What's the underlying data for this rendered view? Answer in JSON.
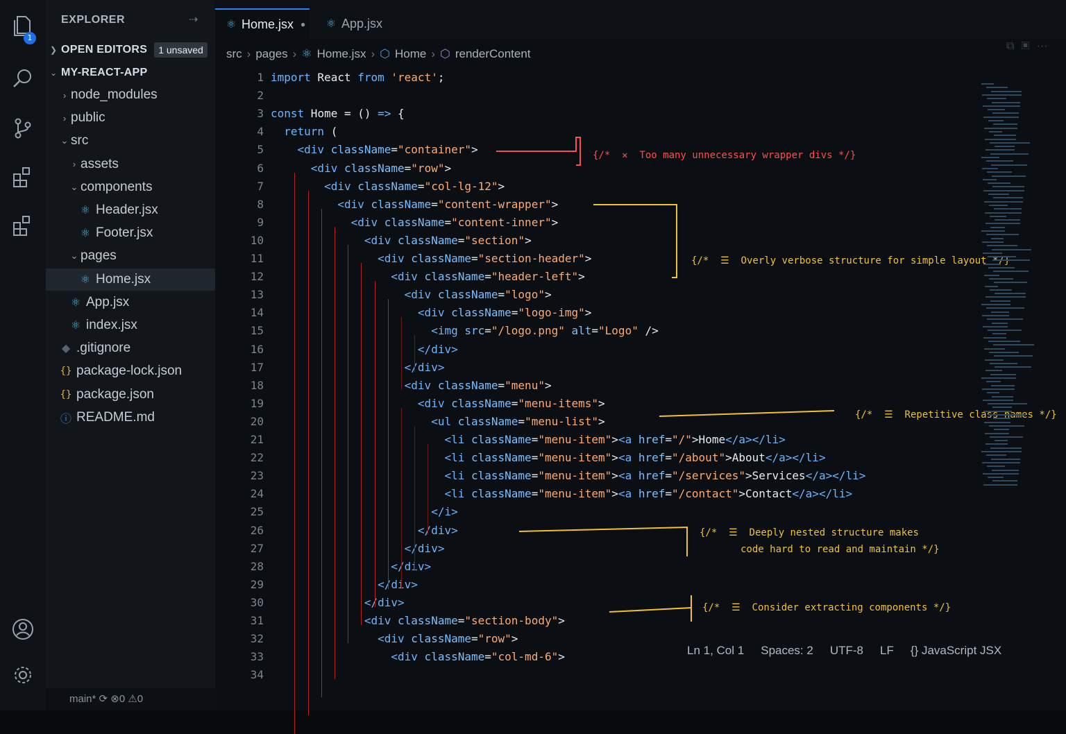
{
  "activity_bar": {
    "explorer_badge": "1"
  },
  "sidebar": {
    "title": "EXPLORER",
    "more_icon": "⇢",
    "open_editors": {
      "label": "OPEN EDITORS",
      "badge": "1 unsaved"
    },
    "project": {
      "label": "MY-REACT-APP"
    },
    "items": [
      {
        "label": "node_modules",
        "type": "folder",
        "state": "collapsed",
        "depth": 1
      },
      {
        "label": "public",
        "type": "folder",
        "state": "collapsed",
        "depth": 1
      },
      {
        "label": "src",
        "type": "folder",
        "state": "expanded",
        "depth": 1
      },
      {
        "label": "assets",
        "type": "folder",
        "state": "collapsed",
        "depth": 2
      },
      {
        "label": "components",
        "type": "folder",
        "state": "expanded",
        "depth": 2
      },
      {
        "label": "Header.jsx",
        "type": "react",
        "depth": 3
      },
      {
        "label": "Footer.jsx",
        "type": "react",
        "depth": 3
      },
      {
        "label": "pages",
        "type": "folder",
        "state": "expanded",
        "depth": 2
      },
      {
        "label": "Home.jsx",
        "type": "react",
        "depth": 3,
        "selected": true
      },
      {
        "label": "App.jsx",
        "type": "react",
        "depth": 2
      },
      {
        "label": "index.jsx",
        "type": "react",
        "depth": 2
      },
      {
        "label": ".gitignore",
        "type": "git",
        "depth": 1
      },
      {
        "label": "package-lock.json",
        "type": "json",
        "depth": 1
      },
      {
        "label": "package.json",
        "type": "json",
        "depth": 1
      },
      {
        "label": "README.md",
        "type": "info",
        "depth": 1
      }
    ],
    "bottom_status": "main*   ⟳   ⊗0 ⚠0"
  },
  "tabs": [
    {
      "label": "Home.jsx",
      "active": true,
      "dirty": true
    },
    {
      "label": "App.jsx",
      "active": false
    }
  ],
  "breadcrumb": [
    "src",
    "pages",
    "Home.jsx",
    "Home",
    "renderContent"
  ],
  "code_lines": [
    [
      [
        "kw",
        "import"
      ],
      [
        "pl",
        " React "
      ],
      [
        "kw",
        "from"
      ],
      [
        "st",
        " 'react'"
      ],
      [
        "pl",
        ";"
      ]
    ],
    [],
    [
      [
        "kw",
        "const"
      ],
      [
        "pl",
        " Home = () "
      ],
      [
        "kw",
        "=>"
      ],
      [
        "pl",
        " {"
      ]
    ],
    [
      [
        "kw",
        "  return"
      ],
      [
        "pl",
        " ("
      ]
    ],
    [
      [
        "tg",
        "    <div"
      ],
      [
        "at",
        " className"
      ],
      [
        "pl",
        "="
      ],
      [
        "st",
        "\"container\""
      ],
      [
        "pl",
        ">"
      ]
    ],
    [
      [
        "tg",
        "      <div"
      ],
      [
        "at",
        " className"
      ],
      [
        "pl",
        "="
      ],
      [
        "st",
        "\"row\""
      ],
      [
        "pl",
        ">"
      ]
    ],
    [
      [
        "tg",
        "        <div"
      ],
      [
        "at",
        " className"
      ],
      [
        "pl",
        "="
      ],
      [
        "st",
        "\"col-lg-12\""
      ],
      [
        "pl",
        ">"
      ]
    ],
    [
      [
        "tg",
        "          <div"
      ],
      [
        "at",
        " className"
      ],
      [
        "pl",
        "="
      ],
      [
        "st",
        "\"content-wrapper\""
      ],
      [
        "pl",
        ">"
      ]
    ],
    [
      [
        "tg",
        "            <div"
      ],
      [
        "at",
        " className"
      ],
      [
        "pl",
        "="
      ],
      [
        "st",
        "\"content-inner\""
      ],
      [
        "pl",
        ">"
      ]
    ],
    [
      [
        "tg",
        "              <div"
      ],
      [
        "at",
        " className"
      ],
      [
        "pl",
        "="
      ],
      [
        "st",
        "\"section\""
      ],
      [
        "pl",
        ">"
      ]
    ],
    [
      [
        "tg",
        "                <div"
      ],
      [
        "at",
        " className"
      ],
      [
        "pl",
        "="
      ],
      [
        "st",
        "\"section-header\""
      ],
      [
        "pl",
        ">"
      ]
    ],
    [
      [
        "tg",
        "                  <div"
      ],
      [
        "at",
        " className"
      ],
      [
        "pl",
        "="
      ],
      [
        "st",
        "\"header-left\""
      ],
      [
        "pl",
        ">"
      ]
    ],
    [
      [
        "tg",
        "                    <div"
      ],
      [
        "at",
        " className"
      ],
      [
        "pl",
        "="
      ],
      [
        "st",
        "\"logo\""
      ],
      [
        "pl",
        ">"
      ]
    ],
    [
      [
        "tg",
        "                      <div"
      ],
      [
        "at",
        " className"
      ],
      [
        "pl",
        "="
      ],
      [
        "st",
        "\"logo-img\""
      ],
      [
        "pl",
        ">"
      ]
    ],
    [
      [
        "tg",
        "                        <img"
      ],
      [
        "at",
        " src"
      ],
      [
        "pl",
        "="
      ],
      [
        "st",
        "\"/logo.png\""
      ],
      [
        "at",
        " alt"
      ],
      [
        "pl",
        "="
      ],
      [
        "st",
        "\"Logo\""
      ],
      [
        "pl",
        " />"
      ]
    ],
    [
      [
        "tg",
        "                      </div>"
      ]
    ],
    [
      [
        "tg",
        "                    </div>"
      ]
    ],
    [
      [
        "tg",
        "                    <div"
      ],
      [
        "at",
        " className"
      ],
      [
        "pl",
        "="
      ],
      [
        "st",
        "\"menu\""
      ],
      [
        "pl",
        ">"
      ]
    ],
    [
      [
        "tg",
        "                      <div"
      ],
      [
        "at",
        " className"
      ],
      [
        "pl",
        "="
      ],
      [
        "st",
        "\"menu-items\""
      ],
      [
        "pl",
        ">"
      ]
    ],
    [
      [
        "tg",
        "                        <ul"
      ],
      [
        "at",
        " className"
      ],
      [
        "pl",
        "="
      ],
      [
        "st",
        "\"menu-list\""
      ],
      [
        "pl",
        ">"
      ]
    ],
    [
      [
        "tg",
        "                          <li"
      ],
      [
        "at",
        " className"
      ],
      [
        "pl",
        "="
      ],
      [
        "st",
        "\"menu-item\""
      ],
      [
        "pl",
        ">"
      ],
      [
        "tg",
        "<a"
      ],
      [
        "at",
        " href"
      ],
      [
        "pl",
        "="
      ],
      [
        "st",
        "\"/\""
      ],
      [
        "pl",
        ">Home"
      ],
      [
        "tg",
        "</a></li>"
      ]
    ],
    [
      [
        "tg",
        "                          <li"
      ],
      [
        "at",
        " className"
      ],
      [
        "pl",
        "="
      ],
      [
        "st",
        "\"menu-item\""
      ],
      [
        "pl",
        ">"
      ],
      [
        "tg",
        "<a"
      ],
      [
        "at",
        " href"
      ],
      [
        "pl",
        "="
      ],
      [
        "st",
        "\"/about\""
      ],
      [
        "pl",
        ">About"
      ],
      [
        "tg",
        "</a></li>"
      ]
    ],
    [
      [
        "tg",
        "                          <li"
      ],
      [
        "at",
        " className"
      ],
      [
        "pl",
        "="
      ],
      [
        "st",
        "\"menu-item\""
      ],
      [
        "pl",
        ">"
      ],
      [
        "tg",
        "<a"
      ],
      [
        "at",
        " href"
      ],
      [
        "pl",
        "="
      ],
      [
        "st",
        "\"/services\""
      ],
      [
        "pl",
        ">Services"
      ],
      [
        "tg",
        "</a></li>"
      ]
    ],
    [
      [
        "tg",
        "                          <li"
      ],
      [
        "at",
        " className"
      ],
      [
        "pl",
        "="
      ],
      [
        "st",
        "\"menu-item\""
      ],
      [
        "pl",
        ">"
      ],
      [
        "tg",
        "<a"
      ],
      [
        "at",
        " href"
      ],
      [
        "pl",
        "="
      ],
      [
        "st",
        "\"/contact\""
      ],
      [
        "pl",
        ">Contact"
      ],
      [
        "tg",
        "</a></li>"
      ]
    ],
    [
      [
        "tg",
        "                        </i>"
      ]
    ],
    [
      [
        "tg",
        "                      </div>"
      ]
    ],
    [
      [
        "tg",
        "                    </div>"
      ]
    ],
    [
      [
        "tg",
        "                  </div>"
      ]
    ],
    [
      [
        "tg",
        "                </div>"
      ]
    ],
    [
      [
        "tg",
        "              </div>"
      ]
    ],
    [
      [
        "tg",
        "              <div"
      ],
      [
        "at",
        " className"
      ],
      [
        "pl",
        "="
      ],
      [
        "st",
        "\"section-body\""
      ],
      [
        "pl",
        ">"
      ]
    ],
    [
      [
        "tg",
        "                <div"
      ],
      [
        "at",
        " className"
      ],
      [
        "pl",
        "="
      ],
      [
        "st",
        "\"row\""
      ],
      [
        "pl",
        ">"
      ]
    ],
    [
      [
        "tg",
        "                  <div"
      ],
      [
        "at",
        " className"
      ],
      [
        "pl",
        "="
      ],
      [
        "st",
        "\"col-md-6\""
      ],
      [
        "pl",
        ">"
      ]
    ],
    []
  ],
  "annotations": [
    {
      "text": "{/*  ✕  Too many unnecessary wrapper divs */}",
      "color": "#ff4d4d"
    },
    {
      "text": "{/*  ☰  Overly verbose structure for simple layout */}",
      "color": "#f2c230"
    },
    {
      "text": "{/*  ☰  Repetitive class names */}",
      "color": "#f2c230"
    },
    {
      "text": "{/*  ☰  Deeply nested structure makes\n       code hard to read and maintain */}",
      "color": "#f2c230"
    },
    {
      "text": "{/*  ☰  Consider extracting components */}",
      "color": "#f2c230"
    }
  ],
  "status_bar": {
    "position": "Ln 1, Col 1",
    "spaces": "Spaces: 2",
    "encoding": "UTF-8",
    "eol": "LF",
    "language": "{} JavaScript JSX"
  }
}
